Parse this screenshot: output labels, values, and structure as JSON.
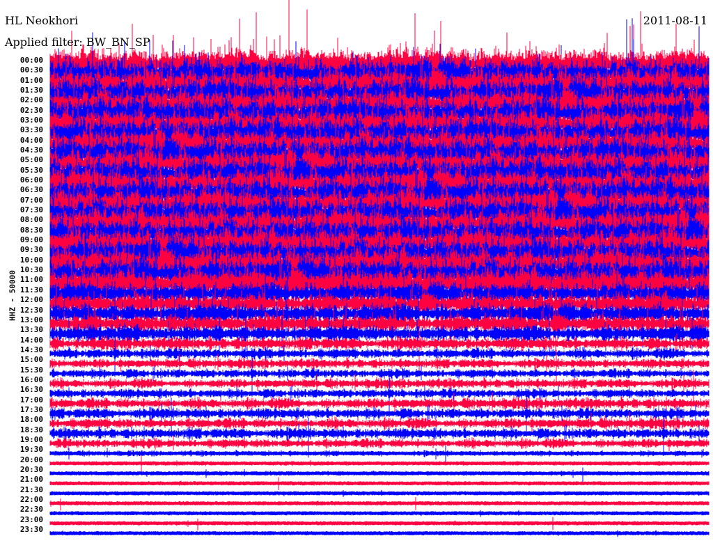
{
  "header": {
    "station": "HL Neokhori",
    "date": "2011-08-11",
    "filter": "Applied filter: BW_BN_SP"
  },
  "chart_data": {
    "type": "line",
    "title": "HL Neokhori 2011-08-11",
    "ylabel": "HHZ - 50000",
    "row_labels": [
      "00:00",
      "00:30",
      "01:00",
      "01:30",
      "02:00",
      "02:30",
      "03:00",
      "03:30",
      "04:00",
      "04:30",
      "05:00",
      "05:30",
      "06:00",
      "06:30",
      "07:00",
      "07:30",
      "08:00",
      "08:30",
      "09:00",
      "09:30",
      "10:00",
      "10:30",
      "11:00",
      "11:30",
      "12:00",
      "12:30",
      "13:00",
      "13:30",
      "14:00",
      "14:30",
      "15:00",
      "15:30",
      "16:00",
      "16:30",
      "17:00",
      "17:30",
      "18:00",
      "18:30",
      "19:00",
      "19:30",
      "20:00",
      "20:30",
      "21:00",
      "21:30",
      "22:00",
      "22:30",
      "23:00",
      "23:30"
    ],
    "series_colors": [
      "#ff0040",
      "#0000ff"
    ],
    "relative_amplitude": [
      1.0,
      1.0,
      1.0,
      1.0,
      1.0,
      1.0,
      1.0,
      1.0,
      1.0,
      1.0,
      1.0,
      1.0,
      1.0,
      1.0,
      1.0,
      1.0,
      1.0,
      1.0,
      0.95,
      0.95,
      0.9,
      0.9,
      0.9,
      0.85,
      0.8,
      0.75,
      0.7,
      0.6,
      0.45,
      0.4,
      0.35,
      0.35,
      0.35,
      0.35,
      0.4,
      0.4,
      0.4,
      0.4,
      0.35,
      0.2,
      0.15,
      0.15,
      0.12,
      0.12,
      0.12,
      0.12,
      0.12,
      0.12
    ]
  }
}
